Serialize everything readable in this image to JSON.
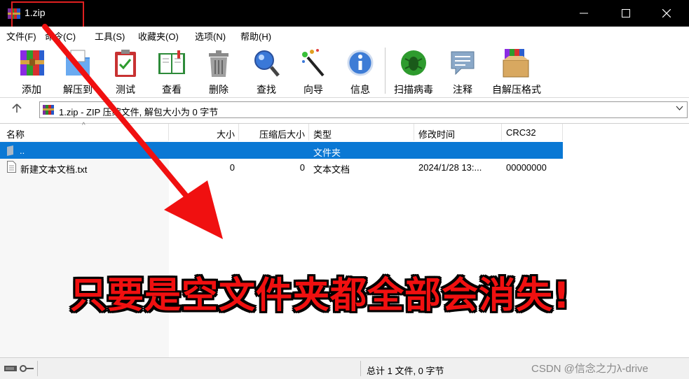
{
  "window": {
    "title": "1.zip"
  },
  "menu": [
    "文件(F)",
    "命令(C)",
    "工具(S)",
    "收藏夹(O)",
    "选项(N)",
    "帮助(H)"
  ],
  "toolbar": {
    "items": [
      {
        "label": "添加",
        "icon": "add-archive-icon"
      },
      {
        "label": "解压到",
        "icon": "extract-to-icon"
      },
      {
        "label": "测试",
        "icon": "test-clipboard-icon"
      },
      {
        "label": "查看",
        "icon": "view-book-icon"
      },
      {
        "label": "删除",
        "icon": "trash-icon"
      },
      {
        "label": "查找",
        "icon": "find-magnifier-icon"
      },
      {
        "label": "向导",
        "icon": "wizard-wand-icon"
      },
      {
        "label": "信息",
        "icon": "info-icon"
      },
      {
        "label": "扫描病毒",
        "icon": "virus-scan-icon"
      },
      {
        "label": "注释",
        "icon": "comment-icon"
      },
      {
        "label": "自解压格式",
        "icon": "sfx-box-icon"
      }
    ]
  },
  "address": {
    "text": "1.zip - ZIP 压缩文件, 解包大小为 0 字节"
  },
  "filelist": {
    "columns": [
      "名称",
      "大小",
      "压缩后大小",
      "类型",
      "修改时间",
      "CRC32"
    ],
    "rows": [
      {
        "name": "..",
        "size": "",
        "packed": "",
        "type": "文件夹",
        "modified": "",
        "crc": ""
      },
      {
        "name": "新建文本文档.txt",
        "size": "0",
        "packed": "0",
        "type": "文本文档",
        "modified": "2024/1/28 13:...",
        "crc": "00000000"
      }
    ]
  },
  "status": {
    "summary": "总计 1 文件, 0 字节",
    "watermark": "CSDN @信念之力λ-drive"
  },
  "overlay": {
    "text": "只要是空文件夹都全部会消失!"
  },
  "colors": {
    "selection": "#0a78d4",
    "annotation": "#f01010",
    "titlebar": "#000000"
  }
}
